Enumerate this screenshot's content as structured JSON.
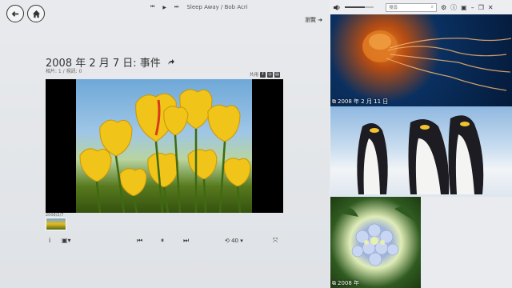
{
  "now_playing": {
    "prev": "⏮",
    "play": "▶",
    "next": "⏭",
    "title": "Sleep Away / Bob Acri"
  },
  "album": {
    "title": "2008 年 2 月 7 日: 事件",
    "meta": "相片: 1 / 視訊: 0",
    "share_label": "共用"
  },
  "thumbnail_strip": {
    "label": "2008/2/7"
  },
  "controls": {
    "info": "i",
    "slideshow": "▣▾",
    "prev": "⏮",
    "pause": "⏸",
    "next": "⏭",
    "repeat": "⟲ 40 ▾",
    "fullscreen": "⤧"
  },
  "top_bar": {
    "search_placeholder": "搜尋"
  },
  "browse": {
    "label": "瀏覽"
  },
  "tiles": [
    {
      "caption": "2008 年 2 月 11 日"
    },
    {
      "caption": ""
    },
    {
      "caption": "2008 年"
    }
  ],
  "colors": {
    "accent": "#333333",
    "background": "#e6e8eb"
  }
}
